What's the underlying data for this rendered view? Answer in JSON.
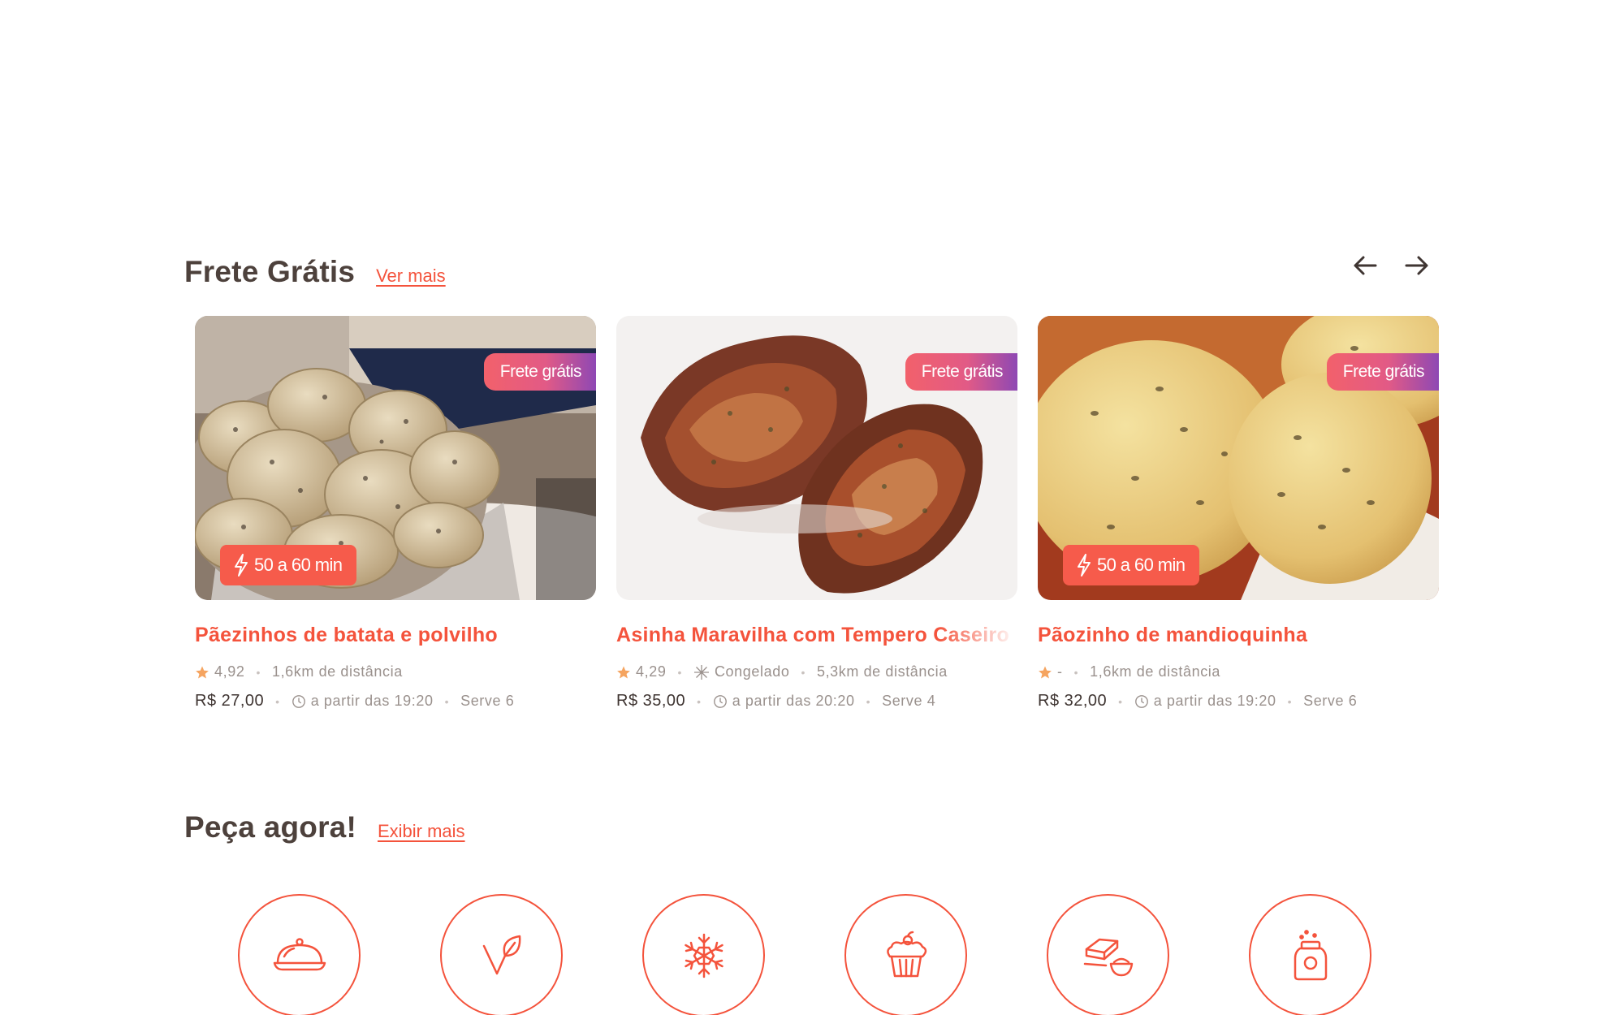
{
  "sections": {
    "frete": {
      "title": "Frete Grátis",
      "link": "Ver mais"
    },
    "peca": {
      "title": "Peça agora!",
      "link": "Exibir mais"
    }
  },
  "colors": {
    "accent": "#f4533c",
    "star": "#f5a460",
    "badge_gradient": [
      "#f2616b",
      "#8e48b4"
    ]
  },
  "cards": [
    {
      "image": "pão de batata e polvilho",
      "badge": "Frete grátis",
      "time": "50 a 60 min",
      "title": "Pãezinhos de batata e polvilho",
      "rating": "4,92",
      "distance": "1,6km de distância",
      "price": "R$ 27,00",
      "from": "a partir das 19:20",
      "serves": "Serve 6"
    },
    {
      "image": "asinha de frango grelhada",
      "badge": "Frete grátis",
      "title": "Asinha Maravilha com Tempero Caseiro",
      "rating": "4,29",
      "frozen": "Congelado",
      "distance": "5,3km de distância",
      "price": "R$ 35,00",
      "from": "a partir das 20:20",
      "serves": "Serve 4"
    },
    {
      "image": "pão de mandioquinha",
      "badge": "Frete grátis",
      "time": "50 a 60 min",
      "title": "Pãozinho de mandioquinha",
      "rating": "-",
      "distance": "1,6km de distância",
      "price": "R$ 32,00",
      "from": "a partir das 19:20",
      "serves": "Serve 6"
    }
  ],
  "categories": [
    {
      "icon": "cloche-icon"
    },
    {
      "icon": "vegan-leaf-icon"
    },
    {
      "icon": "snowflake-icon"
    },
    {
      "icon": "cupcake-icon"
    },
    {
      "icon": "tofu-bowl-icon"
    },
    {
      "icon": "jar-icon"
    }
  ]
}
